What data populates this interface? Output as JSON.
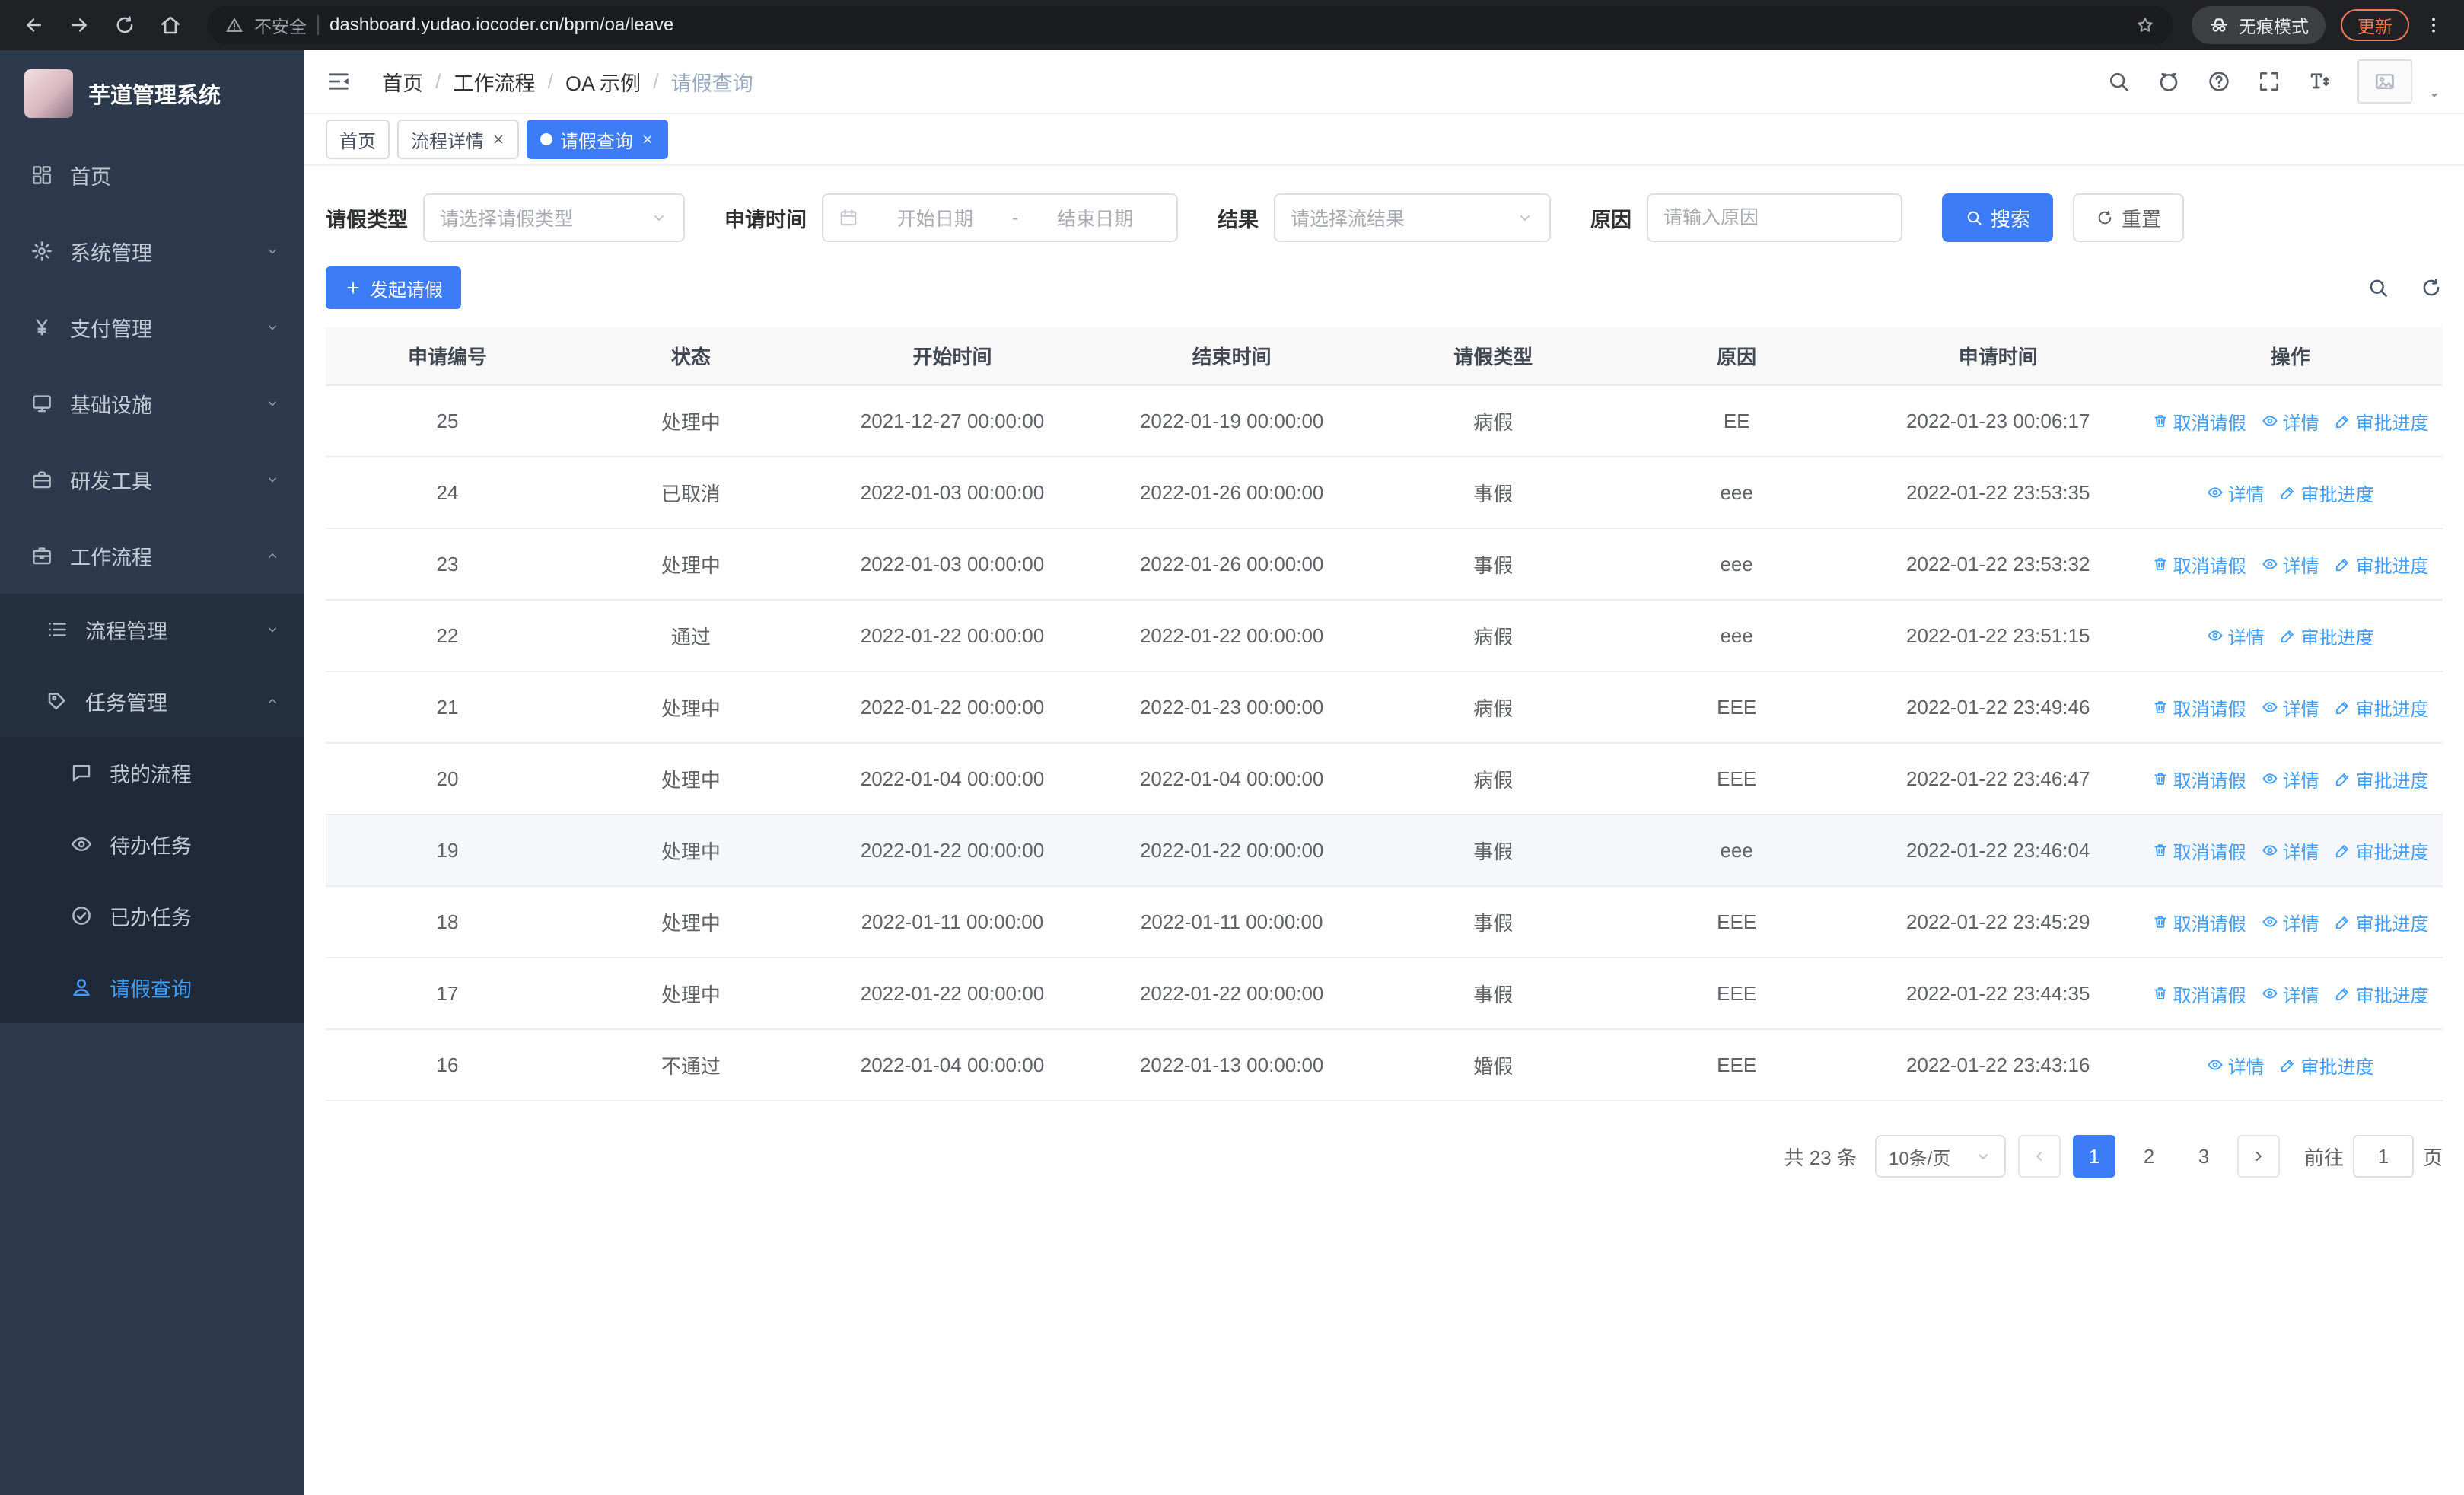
{
  "theme": {
    "accent": "#3d7cf7",
    "link": "#409eff",
    "chrome_bg": "#202124",
    "omnibox_bg": "#1b1c1f",
    "update_color": "#f07b54",
    "sidebar_bg": "#2d3a4d",
    "submenu_bg": "#25303f",
    "submenu2_bg": "#1f2937",
    "table_header_bg": "#f8f8f9"
  },
  "browser": {
    "security_warning": "不安全",
    "url": "dashboard.yudao.iocoder.cn/bpm/oa/leave",
    "incognito_label": "无痕模式",
    "update_label": "更新"
  },
  "sidebar": {
    "app_title": "芋道管理系统",
    "menu": [
      {
        "label": "首页",
        "icon": "dashboard-icon"
      },
      {
        "label": "系统管理",
        "icon": "gear-icon",
        "chevron": "down"
      },
      {
        "label": "支付管理",
        "icon": "yen-icon",
        "chevron": "down"
      },
      {
        "label": "基础设施",
        "icon": "monitor-icon",
        "chevron": "down"
      },
      {
        "label": "研发工具",
        "icon": "toolbox-icon",
        "chevron": "down"
      },
      {
        "label": "工作流程",
        "icon": "briefcase-icon",
        "chevron": "up",
        "children": [
          {
            "label": "流程管理",
            "icon": "list-icon",
            "chevron": "down"
          },
          {
            "label": "任务管理",
            "icon": "tag-icon",
            "chevron": "up",
            "children": [
              {
                "label": "我的流程",
                "icon": "chat-icon"
              },
              {
                "label": "待办任务",
                "icon": "eye-icon"
              },
              {
                "label": "已办任务",
                "icon": "check-circle-icon"
              },
              {
                "label": "请假查询",
                "icon": "user-icon",
                "active": true
              }
            ]
          }
        ]
      }
    ]
  },
  "header": {
    "breadcrumb": [
      "首页",
      "工作流程",
      "OA 示例",
      "请假查询"
    ]
  },
  "tabs": [
    {
      "label": "首页",
      "closable": false,
      "active": false
    },
    {
      "label": "流程详情",
      "closable": true,
      "active": false
    },
    {
      "label": "请假查询",
      "closable": true,
      "active": true
    }
  ],
  "filters": {
    "leave_type_label": "请假类型",
    "leave_type_placeholder": "请选择请假类型",
    "apply_time_label": "申请时间",
    "start_date_placeholder": "开始日期",
    "date_separator": "-",
    "end_date_placeholder": "结束日期",
    "result_label": "结果",
    "result_placeholder": "请选择流结果",
    "reason_label": "原因",
    "reason_placeholder": "请输入原因",
    "search_label": "搜索",
    "reset_label": "重置"
  },
  "toolbar": {
    "create_label": "发起请假"
  },
  "table": {
    "columns": [
      "申请编号",
      "状态",
      "开始时间",
      "结束时间",
      "请假类型",
      "原因",
      "申请时间",
      "操作"
    ],
    "action_defs": {
      "cancel": {
        "label": "取消请假",
        "icon": "trash-icon"
      },
      "detail": {
        "label": "详情",
        "icon": "eye-icon"
      },
      "progress": {
        "label": "审批进度",
        "icon": "edit-icon"
      }
    },
    "rows": [
      {
        "id": "25",
        "status": "处理中",
        "start": "2021-12-27 00:00:00",
        "end": "2022-01-19 00:00:00",
        "type": "病假",
        "reason": "EE",
        "applied": "2022-01-23 00:06:17",
        "actions": [
          "cancel",
          "detail",
          "progress"
        ]
      },
      {
        "id": "24",
        "status": "已取消",
        "start": "2022-01-03 00:00:00",
        "end": "2022-01-26 00:00:00",
        "type": "事假",
        "reason": "eee",
        "applied": "2022-01-22 23:53:35",
        "actions": [
          "detail",
          "progress"
        ]
      },
      {
        "id": "23",
        "status": "处理中",
        "start": "2022-01-03 00:00:00",
        "end": "2022-01-26 00:00:00",
        "type": "事假",
        "reason": "eee",
        "applied": "2022-01-22 23:53:32",
        "actions": [
          "cancel",
          "detail",
          "progress"
        ]
      },
      {
        "id": "22",
        "status": "通过",
        "start": "2022-01-22 00:00:00",
        "end": "2022-01-22 00:00:00",
        "type": "病假",
        "reason": "eee",
        "applied": "2022-01-22 23:51:15",
        "actions": [
          "detail",
          "progress"
        ]
      },
      {
        "id": "21",
        "status": "处理中",
        "start": "2022-01-22 00:00:00",
        "end": "2022-01-23 00:00:00",
        "type": "病假",
        "reason": "EEE",
        "applied": "2022-01-22 23:49:46",
        "actions": [
          "cancel",
          "detail",
          "progress"
        ]
      },
      {
        "id": "20",
        "status": "处理中",
        "start": "2022-01-04 00:00:00",
        "end": "2022-01-04 00:00:00",
        "type": "病假",
        "reason": "EEE",
        "applied": "2022-01-22 23:46:47",
        "actions": [
          "cancel",
          "detail",
          "progress"
        ]
      },
      {
        "id": "19",
        "status": "处理中",
        "start": "2022-01-22 00:00:00",
        "end": "2022-01-22 00:00:00",
        "type": "事假",
        "reason": "eee",
        "applied": "2022-01-22 23:46:04",
        "actions": [
          "cancel",
          "detail",
          "progress"
        ],
        "highlighted": true
      },
      {
        "id": "18",
        "status": "处理中",
        "start": "2022-01-11 00:00:00",
        "end": "2022-01-11 00:00:00",
        "type": "事假",
        "reason": "EEE",
        "applied": "2022-01-22 23:45:29",
        "actions": [
          "cancel",
          "detail",
          "progress"
        ]
      },
      {
        "id": "17",
        "status": "处理中",
        "start": "2022-01-22 00:00:00",
        "end": "2022-01-22 00:00:00",
        "type": "事假",
        "reason": "EEE",
        "applied": "2022-01-22 23:44:35",
        "actions": [
          "cancel",
          "detail",
          "progress"
        ]
      },
      {
        "id": "16",
        "status": "不通过",
        "start": "2022-01-04 00:00:00",
        "end": "2022-01-13 00:00:00",
        "type": "婚假",
        "reason": "EEE",
        "applied": "2022-01-22 23:43:16",
        "actions": [
          "detail",
          "progress"
        ]
      }
    ]
  },
  "pagination": {
    "total_text": "共 23 条",
    "page_size": "10条/页",
    "pages": [
      {
        "label": "1",
        "active": true
      },
      {
        "label": "2",
        "active": false
      },
      {
        "label": "3",
        "active": false
      }
    ],
    "goto_prefix": "前往",
    "goto_value": "1",
    "goto_suffix": "页"
  }
}
